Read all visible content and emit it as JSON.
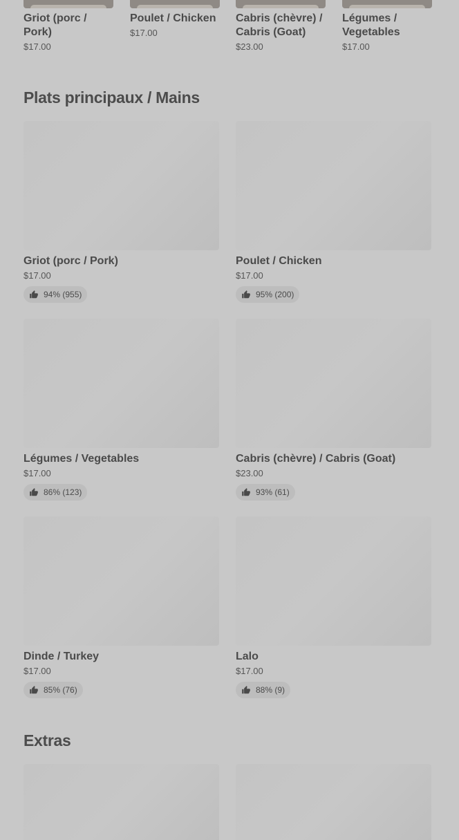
{
  "top_items": [
    {
      "name": "Griot (porc / Pork)",
      "price": "$17.00"
    },
    {
      "name": "Poulet / Chicken",
      "price": "$17.00"
    },
    {
      "name": "Cabris (chèvre) / Cabris (Goat)",
      "price": "$23.00"
    },
    {
      "name": "Légumes / Vegetables",
      "price": "$17.00"
    }
  ],
  "sections": {
    "mains_title": "Plats principaux / Mains",
    "extras_title": "Extras"
  },
  "mains": [
    {
      "name": "Griot (porc / Pork)",
      "price": "$17.00",
      "rating": "94% (955)"
    },
    {
      "name": "Poulet / Chicken",
      "price": "$17.00",
      "rating": "95% (200)"
    },
    {
      "name": "Légumes / Vegetables",
      "price": "$17.00",
      "rating": "86% (123)"
    },
    {
      "name": "Cabris (chèvre) / Cabris (Goat)",
      "price": "$23.00",
      "rating": "93% (61)"
    },
    {
      "name": "Dinde / Turkey",
      "price": "$17.00",
      "rating": "85% (76)"
    },
    {
      "name": "Lalo",
      "price": "$17.00",
      "rating": "88% (9)"
    }
  ],
  "icons": {
    "rating": "thumbs-up-icon"
  },
  "colors": {
    "background": "#c8c8c8",
    "text": "#4a4a4a",
    "badge": "#bdbdbd"
  }
}
